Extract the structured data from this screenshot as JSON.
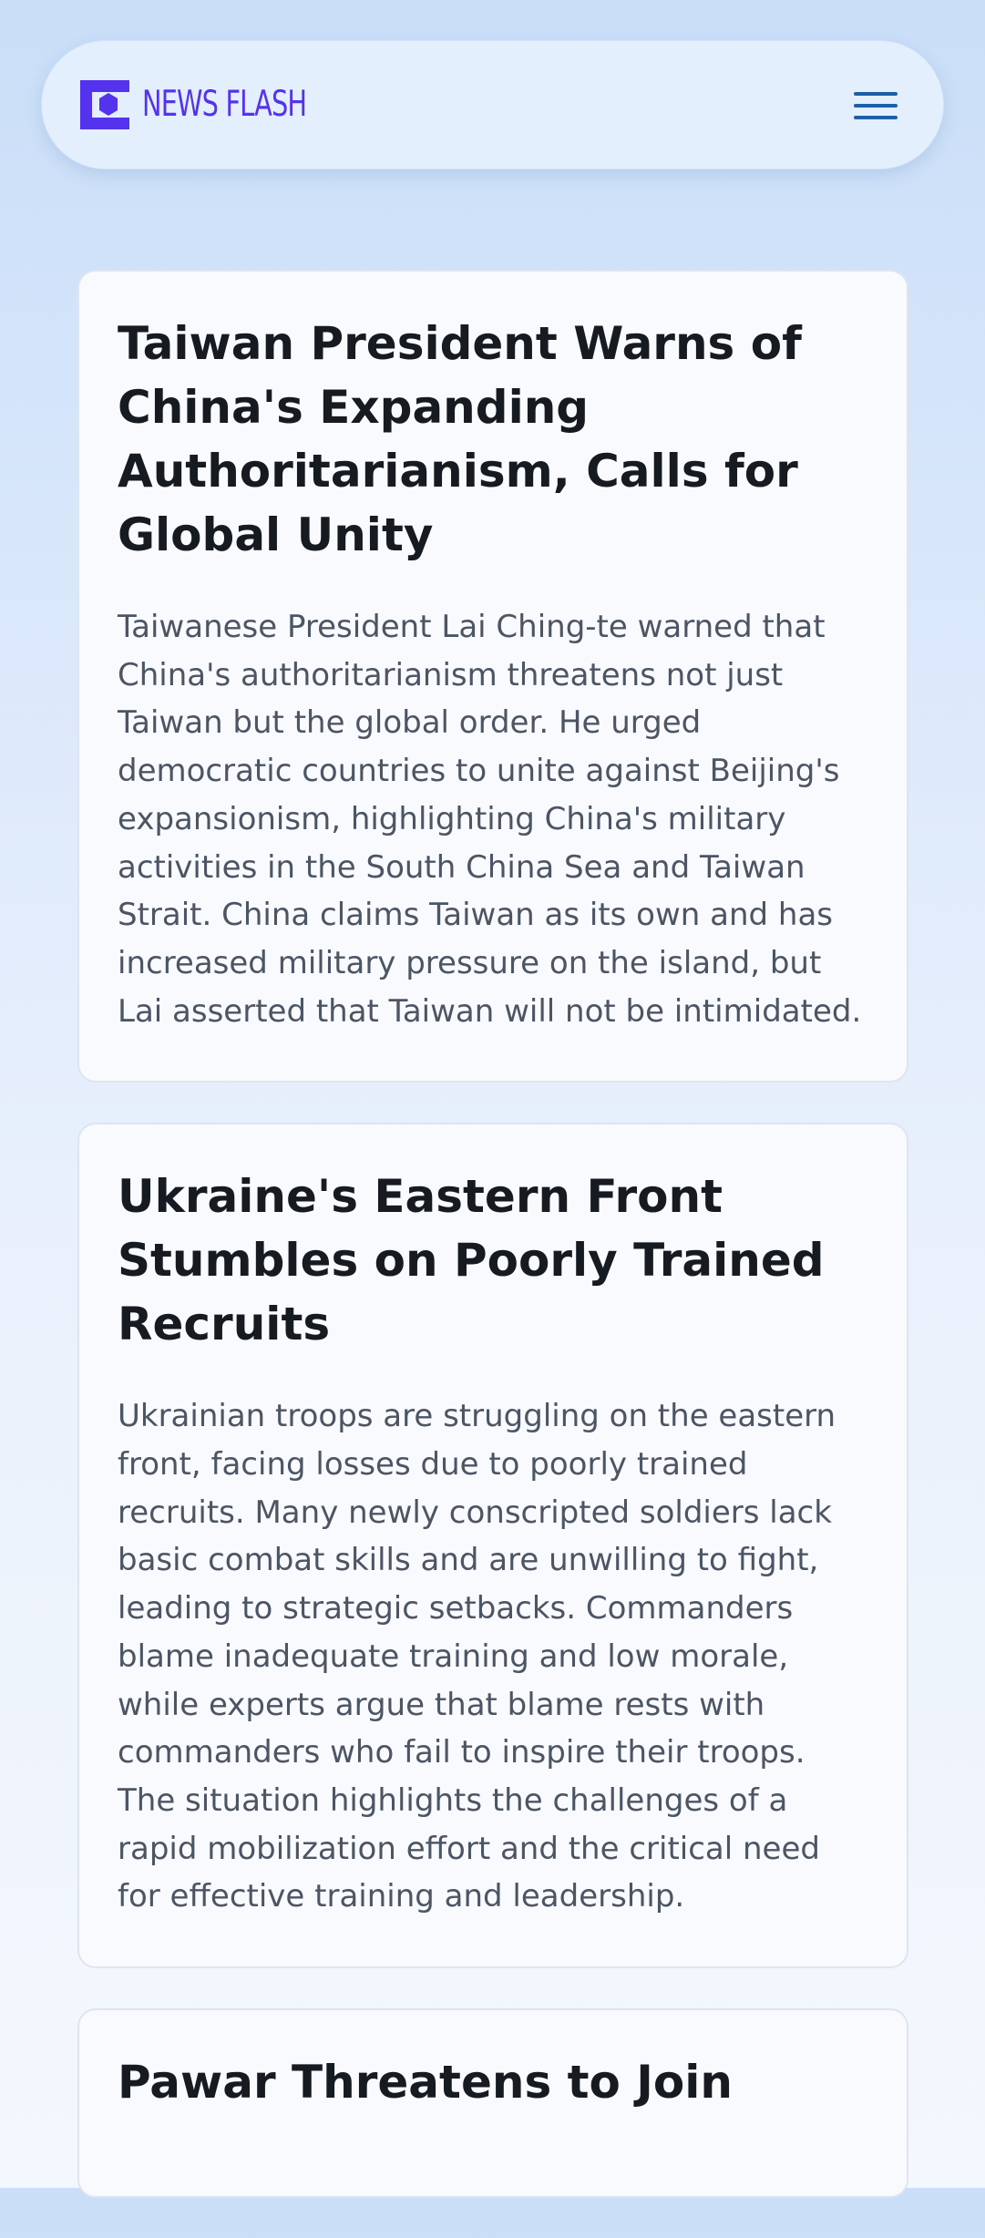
{
  "header": {
    "logo_text": "NEWS FLASH",
    "logo_icon": "hexagon-frame-logo-icon",
    "menu_icon": "hamburger-menu-icon",
    "brand_color": "#5533ee",
    "menu_color": "#1d5fa8"
  },
  "articles": [
    {
      "title": "Taiwan President Warns of China's Expanding Authoritarianism, Calls for Global Unity",
      "summary": "Taiwanese President Lai Ching-te warned that China's authoritarianism threatens not just Taiwan but the global order. He urged democratic countries to unite against Beijing's expansionism, highlighting China's military activities in the South China Sea and Taiwan Strait. China claims Taiwan as its own and has increased military pressure on the island, but Lai asserted that Taiwan will not be intimidated."
    },
    {
      "title": "Ukraine's Eastern Front Stumbles on Poorly Trained Recruits",
      "summary": "Ukrainian troops are struggling on the eastern front, facing losses due to poorly trained recruits. Many newly conscripted soldiers lack basic combat skills and are unwilling to fight, leading to strategic setbacks. Commanders blame inadequate training and low morale, while experts argue that blame rests with commanders who fail to inspire their troops. The situation highlights the challenges of a rapid mobilization effort and the critical need for effective training and leadership."
    },
    {
      "title": "Pawar Threatens to Join",
      "summary": ""
    }
  ]
}
